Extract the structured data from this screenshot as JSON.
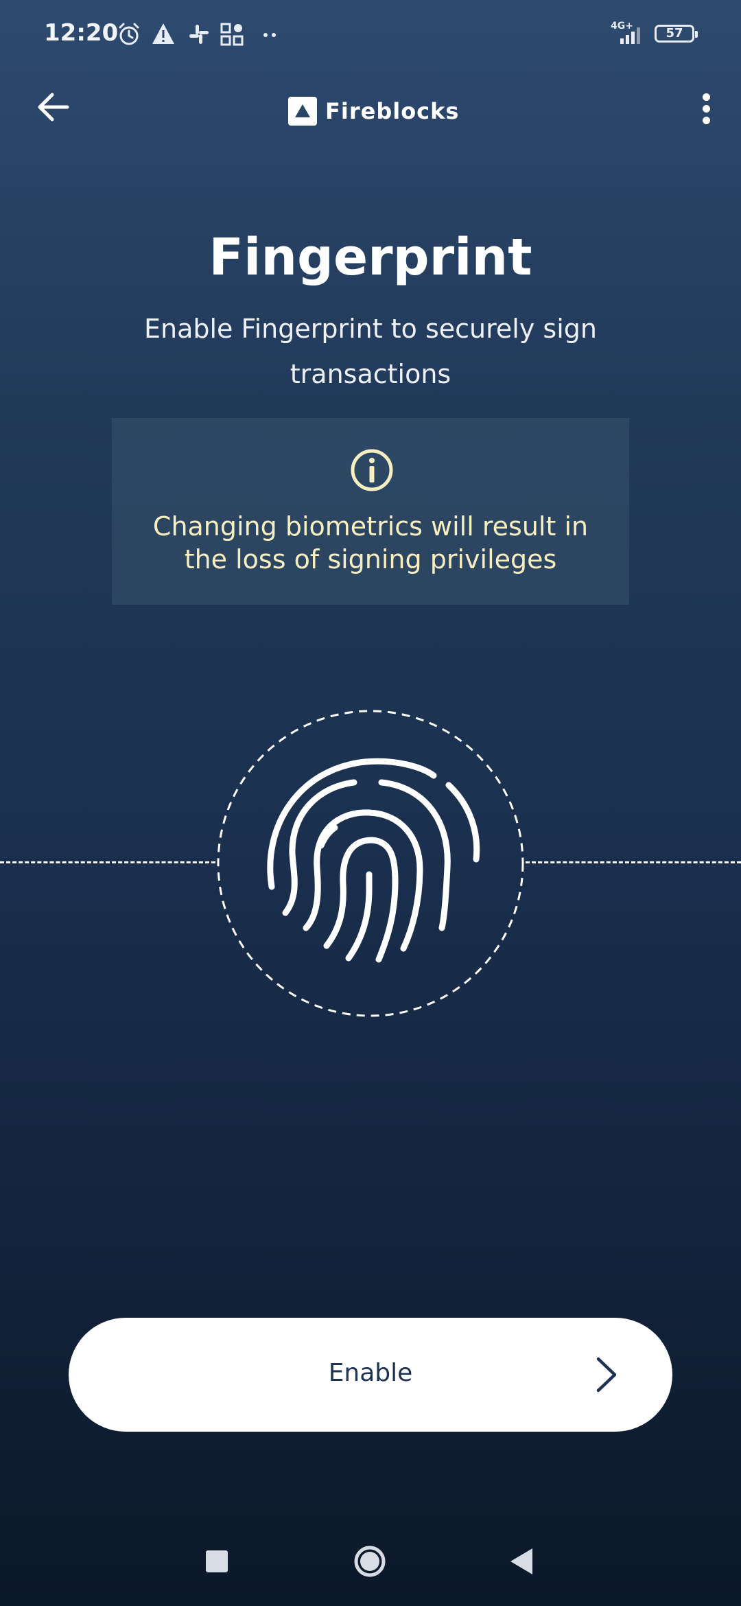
{
  "status_bar": {
    "time": "12:20",
    "network": "4G+",
    "battery": "57"
  },
  "app_bar": {
    "brand": "Fireblocks"
  },
  "page": {
    "title": "Fingerprint",
    "description": "Enable Fingerprint to securely sign transactions"
  },
  "warning": {
    "text": "Changing biometrics will result in the loss of signing privileges",
    "color": "#f6efc2"
  },
  "actions": {
    "enable_label": "Enable"
  },
  "colors": {
    "background_top": "#2e4a6f",
    "background_bottom": "#0b1828",
    "button_text": "#1d3354"
  },
  "icons": {
    "back": "arrow-left-icon",
    "menu": "more-vertical-icon",
    "info": "info-icon",
    "fingerprint": "fingerprint-icon",
    "chevron": "chevron-right-icon"
  }
}
